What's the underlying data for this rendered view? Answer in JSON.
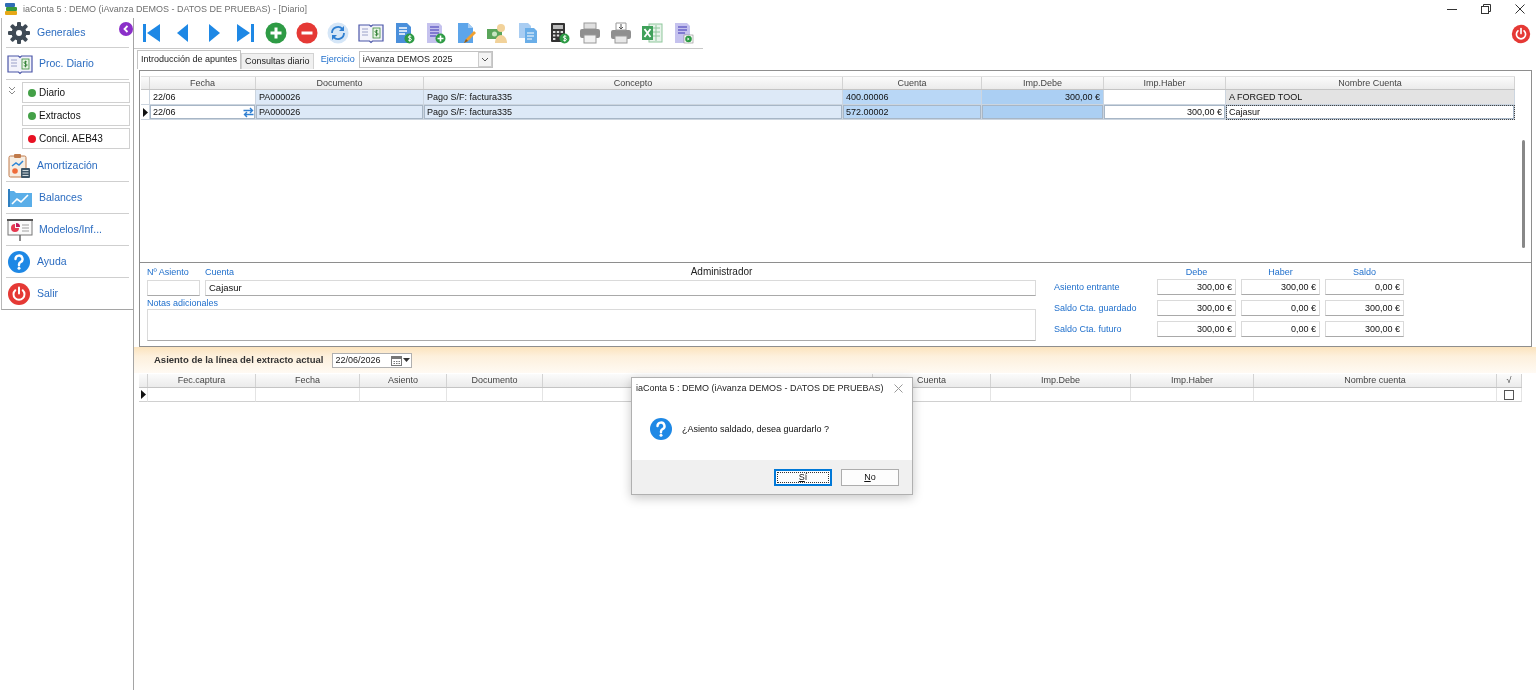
{
  "window": {
    "title": "iaConta 5 : DEMO (iAvanza DEMOS - DATOS DE PRUEBAS) - [Diario]"
  },
  "sidebar": {
    "items": [
      {
        "label": "Generales"
      },
      {
        "label": "Proc. Diario",
        "expanded": true,
        "children": [
          {
            "label": "Diario",
            "color": "#43a047"
          },
          {
            "label": "Extractos",
            "color": "#43a047"
          },
          {
            "label": "Concil. AEB43",
            "color": "#e81123"
          }
        ]
      },
      {
        "label": "Amortización"
      },
      {
        "label": "Balances"
      },
      {
        "label": "Modelos/Inf..."
      },
      {
        "label": "Ayuda"
      },
      {
        "label": "Salir"
      }
    ]
  },
  "tabs": [
    {
      "label": "Introducción de apuntes",
      "selected": true
    },
    {
      "label": "Consultas diario",
      "selected": false
    }
  ],
  "exercise": {
    "label": "Ejercicio",
    "value": "iAvanza DEMOS 2025"
  },
  "journal": {
    "columns": [
      "Fecha",
      "Documento",
      "Concepto",
      "Cuenta",
      "Imp.Debe",
      "Imp.Haber",
      "Nombre Cuenta"
    ],
    "rows": [
      {
        "selected": false,
        "cells": [
          "22/06",
          "PA000026",
          "Pago S/F: factura335",
          "400.00006",
          "300,00 €",
          null,
          "A FORGED TOOL"
        ]
      },
      {
        "selected": true,
        "cells": [
          "22/06",
          "PA000026",
          "Pago S/F: factura335",
          "572.00002",
          null,
          "300,00 €",
          "Cajasur"
        ]
      }
    ]
  },
  "entry": {
    "number": {
      "label": "Nº Asiento"
    },
    "account": {
      "label": "Cuenta",
      "value": "Cajasur"
    },
    "user": "Administrador",
    "notes": {
      "label": "Notas adicionales"
    }
  },
  "totals": {
    "columns": [
      "Debe",
      "Haber",
      "Saldo"
    ],
    "rows": [
      {
        "label": "Asiento entrante",
        "values": [
          "300,00 €",
          "300,00 €",
          "0,00 €"
        ]
      },
      {
        "label": "Saldo Cta. guardado",
        "values": [
          "300,00 €",
          "0,00 €",
          "300,00 €"
        ]
      },
      {
        "label": "Saldo Cta. futuro",
        "values": [
          "300,00 €",
          "0,00 €",
          "300,00 €"
        ]
      }
    ]
  },
  "extract": {
    "title": "Asiento de la línea del extracto actual",
    "date": "22/06/2026",
    "columns": [
      "Fec.captura",
      "Fecha",
      "Asiento",
      "Documento",
      "Cuenta",
      "Imp.Debe",
      "Imp.Haber",
      "Nombre cuenta",
      "√"
    ],
    "rows": [
      {
        "selected": true,
        "checked": false
      }
    ]
  },
  "dialog": {
    "title": "iaConta 5 : DEMO (iAvanza DEMOS - DATOS DE PRUEBAS)",
    "message": "¿Asiento saldado, desea guardarlo ?",
    "buttons": [
      {
        "label": "Sí",
        "default": true
      },
      {
        "label": "No",
        "default": false
      }
    ]
  }
}
